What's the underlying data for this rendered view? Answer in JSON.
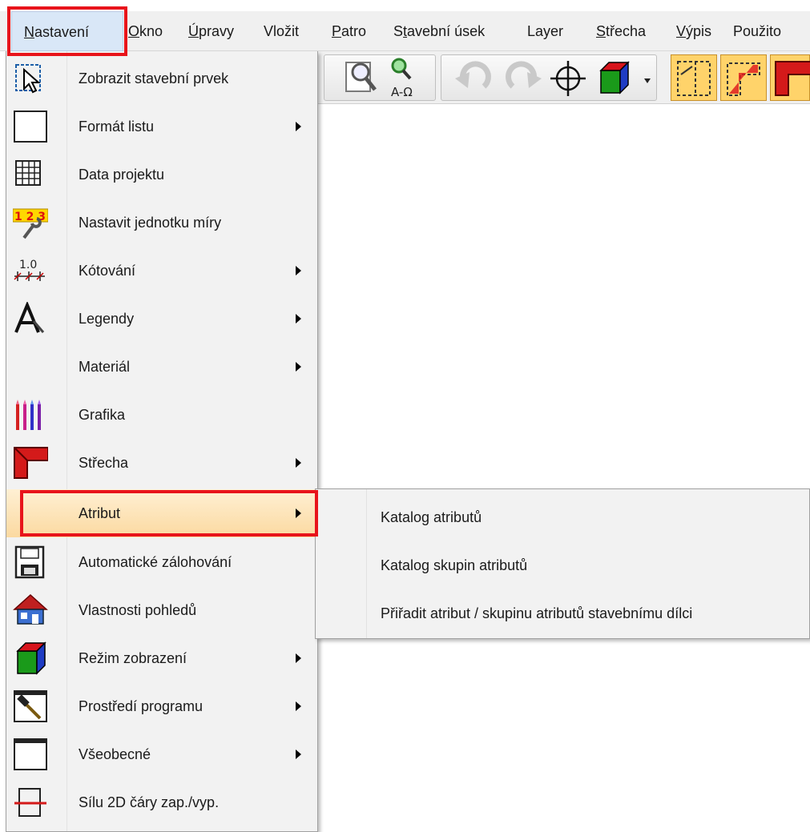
{
  "menubar": {
    "items": [
      {
        "label": "Nastavení",
        "accel": "N",
        "rest": "astavení"
      },
      {
        "label": "Okno",
        "accel": "O",
        "rest": "kno"
      },
      {
        "label": "Úpravy",
        "accel": "Ú",
        "rest": "pravy"
      },
      {
        "label": "Vložit"
      },
      {
        "label": "Patro",
        "accel": "P",
        "rest": "atro"
      },
      {
        "label": "Stavební úsek",
        "pre": "S",
        "accel": "t",
        "rest": "avební úsek"
      },
      {
        "label": "Layer"
      },
      {
        "label": "Střecha",
        "accel": "S",
        "rest": "třecha"
      },
      {
        "label": "Výpis",
        "accel": "V",
        "rest": "ýpis"
      },
      {
        "label": "Použito"
      }
    ]
  },
  "menu": {
    "items": [
      {
        "label": "Zobrazit stavební prvek",
        "icon": "select-element-icon",
        "submenu": false
      },
      {
        "label": "Formát listu",
        "icon": "sheet-format-icon",
        "submenu": true
      },
      {
        "label": "Data projektu",
        "icon": "project-data-grid-icon",
        "submenu": false
      },
      {
        "label": "Nastavit jednotku míry",
        "icon": "unit-ruler-wrench-icon",
        "submenu": false
      },
      {
        "label": "Kótování",
        "icon": "dimension-icon",
        "submenu": true
      },
      {
        "label": "Legendy",
        "icon": "legend-letter-a-icon",
        "submenu": true
      },
      {
        "label": "Materiál",
        "icon": "",
        "submenu": true
      },
      {
        "label": "Grafika",
        "icon": "pencils-icon",
        "submenu": false
      },
      {
        "label": "Střecha",
        "icon": "roof-icon",
        "submenu": true
      },
      {
        "label": "Atribut",
        "icon": "",
        "submenu": true,
        "highlighted": true
      },
      {
        "label": "Automatické zálohování",
        "icon": "floppy-disk-icon",
        "submenu": false
      },
      {
        "label": "Vlastnosti pohledů",
        "icon": "house-3d-icon",
        "submenu": false
      },
      {
        "label": "Režim zobrazení",
        "icon": "color-cube-icon",
        "submenu": true
      },
      {
        "label": "Prostředí programu",
        "icon": "hammer-window-icon",
        "submenu": true
      },
      {
        "label": "Všeobecné",
        "icon": "blank-window-icon",
        "submenu": true
      },
      {
        "label": "Sílu  2D čáry zap./vyp.",
        "icon": "line-weight-icon",
        "submenu": false
      }
    ]
  },
  "submenu": {
    "items": [
      {
        "label": "Katalog atributů"
      },
      {
        "label": "Katalog skupin atributů"
      },
      {
        "label": "Přiřadit atribut / skupinu atributů stavebnímu dílci"
      }
    ]
  },
  "icons": {
    "toolbar": [
      "zoom-window-icon",
      "zoom-text-icon",
      "undo-icon",
      "redo-icon",
      "crosshair-icon",
      "color-cube-icon",
      "dropdown-arrow-icon",
      "yellow-layout-icon",
      "yellow-roof-icon",
      "yellow-roof-red-icon"
    ]
  },
  "colors": {
    "highlight_box": "#e8141b",
    "menu_hover": "#fbd9a0",
    "toolbar_active": "#ffd36a"
  }
}
